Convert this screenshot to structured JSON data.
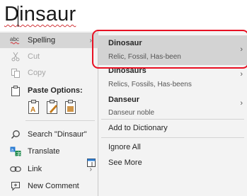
{
  "document": {
    "word": "Dinsaur"
  },
  "context_menu": {
    "spelling": "Spelling",
    "cut": "Cut",
    "copy": "Copy",
    "paste_options": "Paste Options:",
    "search": "Search \"Dinsaur\"",
    "translate": "Translate",
    "link": "Link",
    "new_comment": "New Comment"
  },
  "spelling_submenu": {
    "suggestions": [
      {
        "word": "Dinosaur",
        "synonyms": "Relic, Fossil, Has-been"
      },
      {
        "word": "Dinosaurs",
        "synonyms": "Relics, Fossils, Has-beens"
      },
      {
        "word": "Danseur",
        "synonyms": "Danseur noble"
      }
    ],
    "add_to_dictionary": "Add to Dictionary",
    "ignore_all": "Ignore All",
    "see_more": "See More"
  },
  "colors": {
    "highlight_box": "#e81123",
    "menu_bg": "#f3f3f3",
    "selected_bg": "#d6d6d6"
  }
}
